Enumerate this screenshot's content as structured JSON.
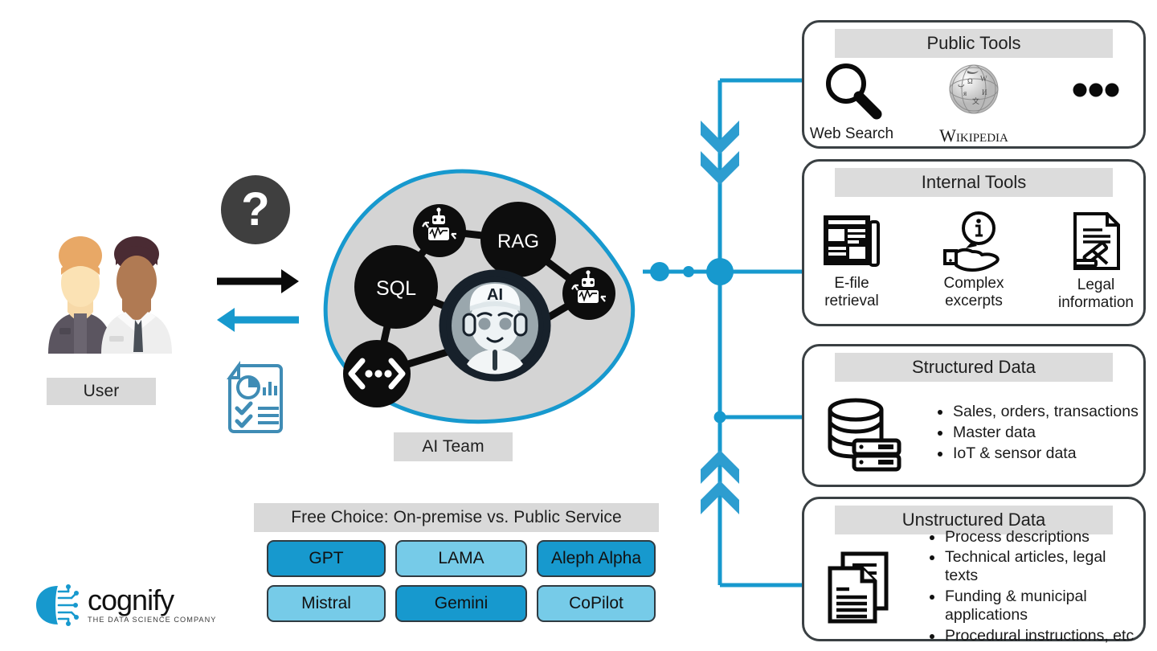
{
  "brand": {
    "name": "cognify",
    "tagline": "THE DATA SCIENCE COMPANY",
    "accent": "#1799ce"
  },
  "colors": {
    "accent_blue": "#1799ce",
    "light_blue": "#76cbe8",
    "band_grey": "#d9d9d9",
    "outline": "#3a4043",
    "blob_fill": "#d4d4d4",
    "node_black": "#0d0d0d"
  },
  "left": {
    "user_label": "User",
    "question_icon": "question-mark-icon",
    "arrow_request_icon": "arrow-right-icon",
    "arrow_response_icon": "arrow-left-icon",
    "report_icon": "report-document-icon",
    "user_icon": "two-users-avatar"
  },
  "ai_team": {
    "label": "AI Team",
    "nodes": [
      {
        "id": "agent-top",
        "label": "",
        "icon": "robot-icon"
      },
      {
        "id": "rag",
        "label": "RAG",
        "icon": ""
      },
      {
        "id": "sql",
        "label": "SQL",
        "icon": ""
      },
      {
        "id": "code",
        "label": "",
        "icon": "code-brackets-icon"
      },
      {
        "id": "agent-right",
        "label": "",
        "icon": "robot-icon"
      },
      {
        "id": "center",
        "label": "AI",
        "icon": "ai-agent-avatar"
      }
    ]
  },
  "model_choice": {
    "header": "Free Choice: On-premise vs. Public Service",
    "options": [
      {
        "label": "GPT",
        "variant": "dark"
      },
      {
        "label": "LAMA",
        "variant": "light"
      },
      {
        "label": "Aleph Alpha",
        "variant": "dark"
      },
      {
        "label": "Mistral",
        "variant": "light"
      },
      {
        "label": "Gemini",
        "variant": "dark"
      },
      {
        "label": "CoPilot",
        "variant": "light"
      }
    ]
  },
  "panels": [
    {
      "id": "public-tools",
      "title": "Public Tools",
      "kind": "tools",
      "tools": [
        {
          "label": "Web Search",
          "icon": "magnifier-icon",
          "style": "sans"
        },
        {
          "label": "Wikipedia",
          "icon": "wikipedia-globe-icon",
          "style": "serif"
        },
        {
          "label": "",
          "icon": "ellipsis-icon",
          "style": "sans"
        }
      ]
    },
    {
      "id": "internal-tools",
      "title": "Internal Tools",
      "kind": "tools",
      "tools": [
        {
          "label": "E-file\nretrieval",
          "icon": "newspaper-icon",
          "style": "sans"
        },
        {
          "label": "Complex\nexcerpts",
          "icon": "hand-info-icon",
          "style": "sans"
        },
        {
          "label": "Legal\ninformation",
          "icon": "legal-document-gavel-icon",
          "style": "sans"
        }
      ]
    },
    {
      "id": "structured-data",
      "title": "Structured Data",
      "kind": "bullets",
      "icon": "database-server-icon",
      "bullets": [
        "Sales, orders, transactions",
        "Master data",
        "IoT & sensor data"
      ]
    },
    {
      "id": "unstructured-data",
      "title": "Unstructured Data",
      "kind": "bullets",
      "icon": "documents-stack-icon",
      "bullets": [
        "Process descriptions",
        "Technical articles, legal texts",
        "Funding & municipal applications",
        "Procedural instructions, etc"
      ]
    }
  ]
}
